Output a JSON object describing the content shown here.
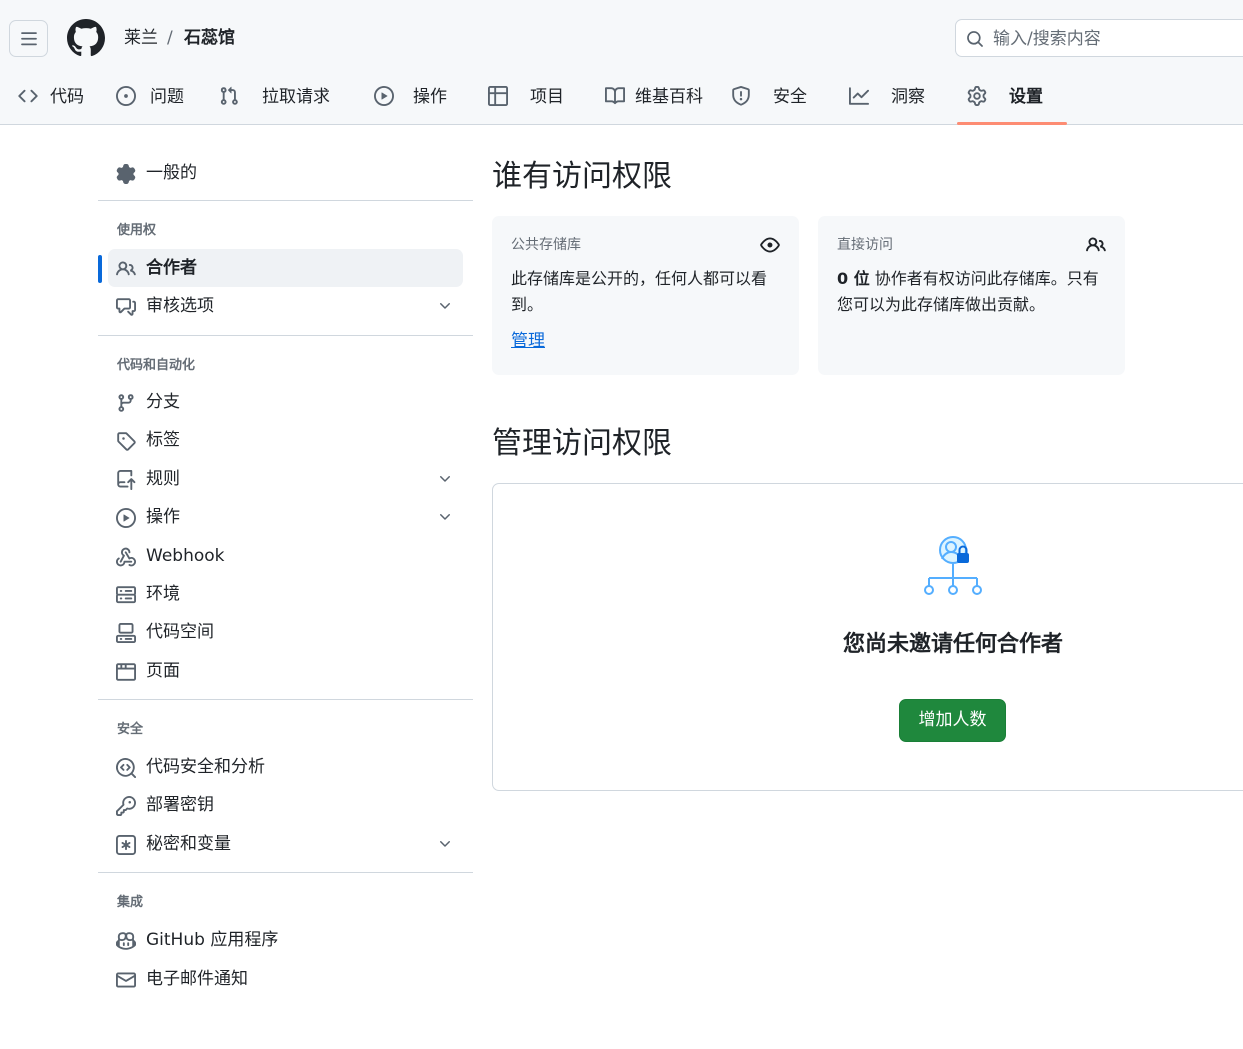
{
  "header": {
    "owner": "莱兰",
    "separator": "/",
    "repo": "石蕊馆",
    "search_placeholder": "输入/搜索内容",
    "icons": {
      "menu": "hamburger-icon",
      "logo": "github-logo",
      "search": "search-icon"
    }
  },
  "tabs": [
    {
      "label": "代码",
      "icon": "code-icon"
    },
    {
      "label": "问题",
      "icon": "issue-icon"
    },
    {
      "label": "拉取请求",
      "icon": "pull-request-icon"
    },
    {
      "label": "操作",
      "icon": "play-icon"
    },
    {
      "label": "项目",
      "icon": "table-icon"
    },
    {
      "label": "维基百科",
      "icon": "book-icon"
    },
    {
      "label": "安全",
      "icon": "shield-icon"
    },
    {
      "label": "洞察",
      "icon": "graph-icon"
    },
    {
      "label": "设置",
      "icon": "gear-icon",
      "active": true
    }
  ],
  "sidebar": {
    "general": "一般的",
    "sections": [
      {
        "title": "使用权",
        "items": [
          {
            "label": "合作者",
            "icon": "people-icon",
            "active": true
          },
          {
            "label": "审核选项",
            "icon": "comment-discussion-icon",
            "expandable": true
          }
        ]
      },
      {
        "title": "代码和自动化",
        "items": [
          {
            "label": "分支",
            "icon": "branch-icon"
          },
          {
            "label": "标签",
            "icon": "tag-icon"
          },
          {
            "label": "规则",
            "icon": "repo-push-icon",
            "expandable": true
          },
          {
            "label": "操作",
            "icon": "play-icon",
            "expandable": true
          },
          {
            "label": "Webhook",
            "icon": "webhook-icon"
          },
          {
            "label": "环境",
            "icon": "server-icon"
          },
          {
            "label": "代码空间",
            "icon": "codespaces-icon"
          },
          {
            "label": "页面",
            "icon": "browser-icon"
          }
        ]
      },
      {
        "title": "安全",
        "items": [
          {
            "label": "代码安全和分析",
            "icon": "codescan-icon"
          },
          {
            "label": "部署密钥",
            "icon": "key-icon"
          },
          {
            "label": "秘密和变量",
            "icon": "key-asterisk-icon",
            "expandable": true
          }
        ]
      },
      {
        "title": "集成",
        "items": [
          {
            "label": "GitHub 应用程序",
            "icon": "copilot-icon"
          },
          {
            "label": "电子邮件通知",
            "icon": "mail-icon"
          }
        ]
      }
    ]
  },
  "main": {
    "access_title": "谁有访问权限",
    "public_card": {
      "title": "公共存储库",
      "body": "此存储库是公开的，任何人都可以看到。",
      "link": "管理",
      "icon": "eye-icon"
    },
    "direct_card": {
      "title": "直接访问",
      "count": "0 位",
      "body": " 协作者有权访问此存储库。只有您可以为此存储库做出贡献。",
      "icon": "people-icon"
    },
    "manage_title": "管理访问权限",
    "empty_title": "您尚未邀请任何合作者",
    "add_button": "增加人数",
    "colors": {
      "accent": "#0969da",
      "primary_button": "#1f883d",
      "tab_underline": "#fd8c73"
    }
  }
}
